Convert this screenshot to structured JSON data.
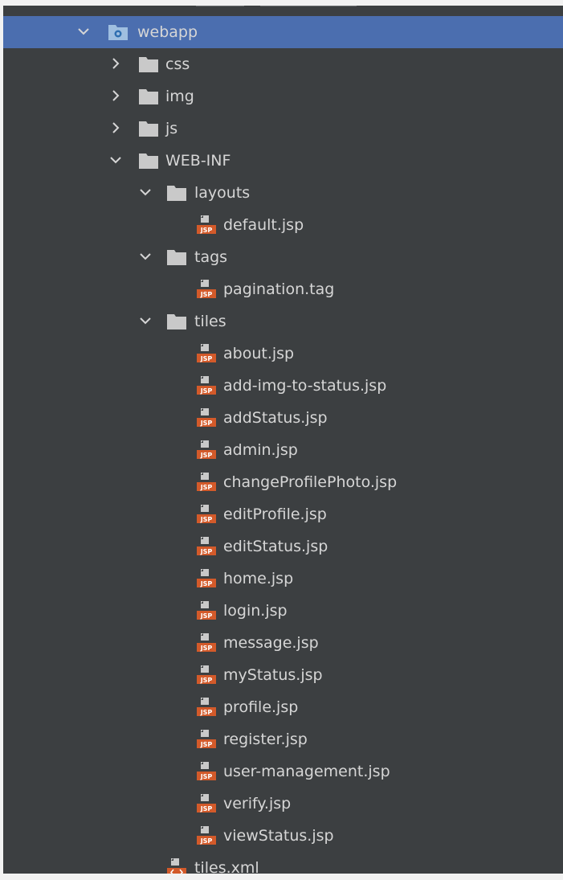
{
  "colors": {
    "panel_bg": "#3c3f41",
    "selection": "#4b6eaf",
    "text": "#d6d6d6",
    "folder": "#c9c9c9",
    "jsp_badge": "#d35a2a"
  },
  "tree": {
    "rows": [
      {
        "label": "webapp",
        "icon": "web-folder-icon",
        "expanded": true,
        "selected": true
      },
      {
        "label": "css",
        "icon": "folder-icon",
        "expanded": false
      },
      {
        "label": "img",
        "icon": "folder-icon",
        "expanded": false
      },
      {
        "label": "js",
        "icon": "folder-icon",
        "expanded": false
      },
      {
        "label": "WEB-INF",
        "icon": "folder-icon",
        "expanded": true
      },
      {
        "label": "layouts",
        "icon": "folder-icon",
        "expanded": true
      },
      {
        "label": "default.jsp",
        "icon": "jsp-file-icon"
      },
      {
        "label": "tags",
        "icon": "folder-icon",
        "expanded": true
      },
      {
        "label": "pagination.tag",
        "icon": "jsp-file-icon"
      },
      {
        "label": "tiles",
        "icon": "folder-icon",
        "expanded": true
      },
      {
        "label": "about.jsp",
        "icon": "jsp-file-icon"
      },
      {
        "label": "add-img-to-status.jsp",
        "icon": "jsp-file-icon"
      },
      {
        "label": "addStatus.jsp",
        "icon": "jsp-file-icon"
      },
      {
        "label": "admin.jsp",
        "icon": "jsp-file-icon"
      },
      {
        "label": "changeProfilePhoto.jsp",
        "icon": "jsp-file-icon"
      },
      {
        "label": "editProfile.jsp",
        "icon": "jsp-file-icon"
      },
      {
        "label": "editStatus.jsp",
        "icon": "jsp-file-icon"
      },
      {
        "label": "home.jsp",
        "icon": "jsp-file-icon"
      },
      {
        "label": "login.jsp",
        "icon": "jsp-file-icon"
      },
      {
        "label": "message.jsp",
        "icon": "jsp-file-icon"
      },
      {
        "label": "myStatus.jsp",
        "icon": "jsp-file-icon"
      },
      {
        "label": "profile.jsp",
        "icon": "jsp-file-icon"
      },
      {
        "label": "register.jsp",
        "icon": "jsp-file-icon"
      },
      {
        "label": "user-management.jsp",
        "icon": "jsp-file-icon"
      },
      {
        "label": "verify.jsp",
        "icon": "jsp-file-icon"
      },
      {
        "label": "viewStatus.jsp",
        "icon": "jsp-file-icon"
      },
      {
        "label": "tiles.xml",
        "icon": "xml-file-icon"
      }
    ]
  }
}
